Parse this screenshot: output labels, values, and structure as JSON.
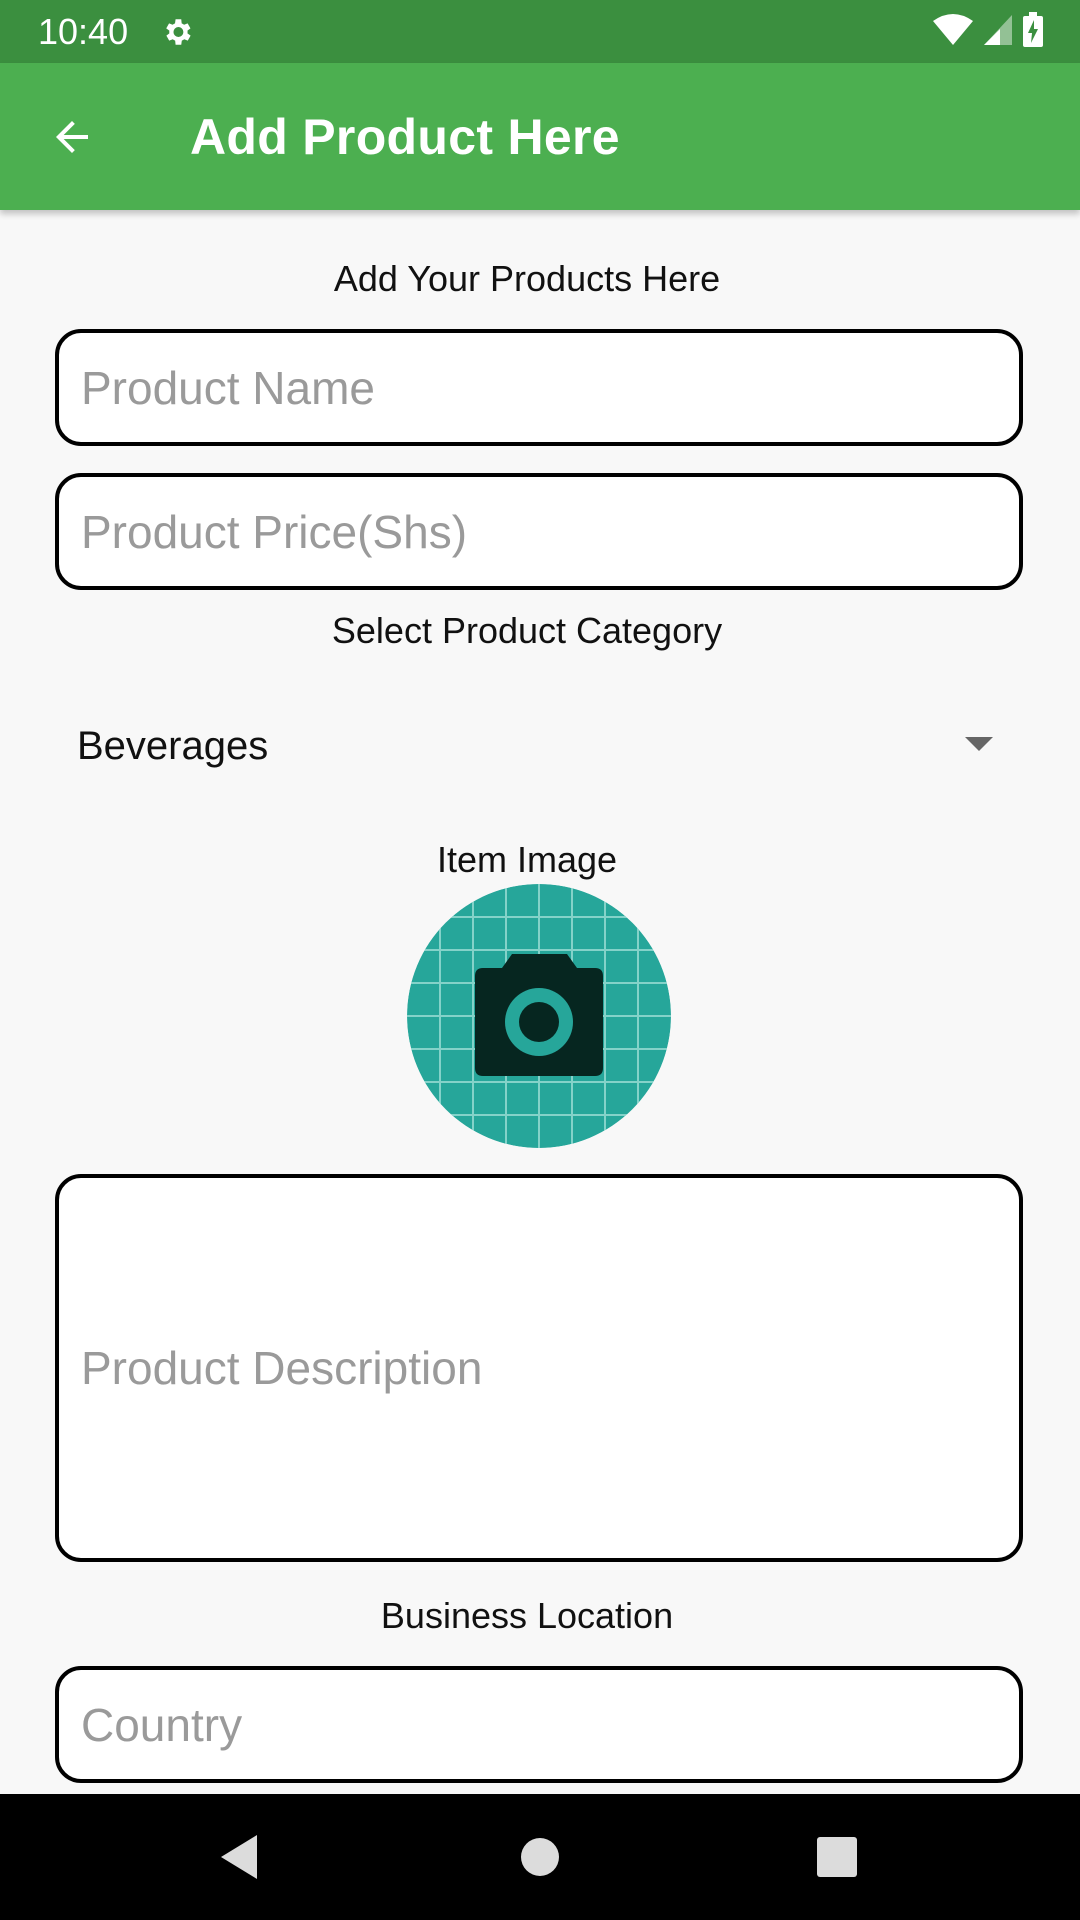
{
  "status_bar": {
    "time": "10:40",
    "icons": [
      "gear-icon",
      "wifi-icon",
      "signal-icon",
      "battery-charging-icon"
    ]
  },
  "app_bar": {
    "title": "Add Product Here",
    "back_icon": "arrow-back-icon",
    "color": "#4caf50",
    "status_color": "#3b8f3f"
  },
  "form": {
    "heading": "Add Your Products Here",
    "product_name_placeholder": "Product Name",
    "product_price_placeholder": "Product Price(Shs)",
    "category_label": "Select Product Category",
    "category_selected": "Beverages",
    "image_label": "Item Image",
    "image_icon": "camera-icon",
    "description_placeholder": "Product Description",
    "location_label": "Business Location",
    "country_placeholder": "Country"
  },
  "nav_bar": {
    "icons": [
      "back-triangle-icon",
      "home-circle-icon",
      "recents-square-icon"
    ]
  }
}
